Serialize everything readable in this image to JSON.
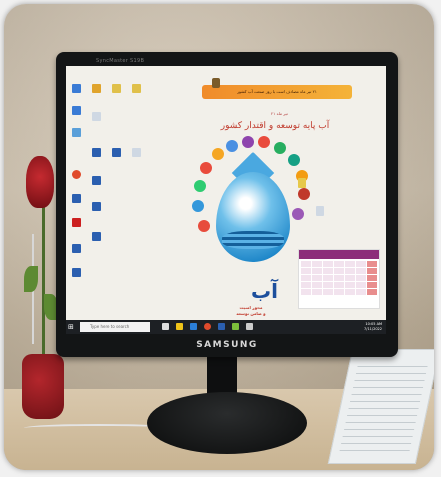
{
  "monitor": {
    "brand": "SAMSUNG",
    "model_top": "SyncMaster S19B"
  },
  "desktop": {
    "banner_text": "۲۱ تیر ماه مصادف است با روز صنعت آب کشور",
    "subtitle": "۲۱ تیر ماه",
    "title": "آب پایه توسعه و اقتدار کشور",
    "big_letter": "آب",
    "tagline_1": "محور امنیت",
    "tagline_2": "و ضامن توسعه",
    "search_placeholder": "Type here to search",
    "clock_time": "10:05 AM",
    "clock_date": "7/11/2022"
  },
  "colors": {
    "banner": "#f08b2a",
    "drop": "#1f87c9",
    "calendar_header": "#8c2d7a",
    "title": "#c0392b"
  }
}
